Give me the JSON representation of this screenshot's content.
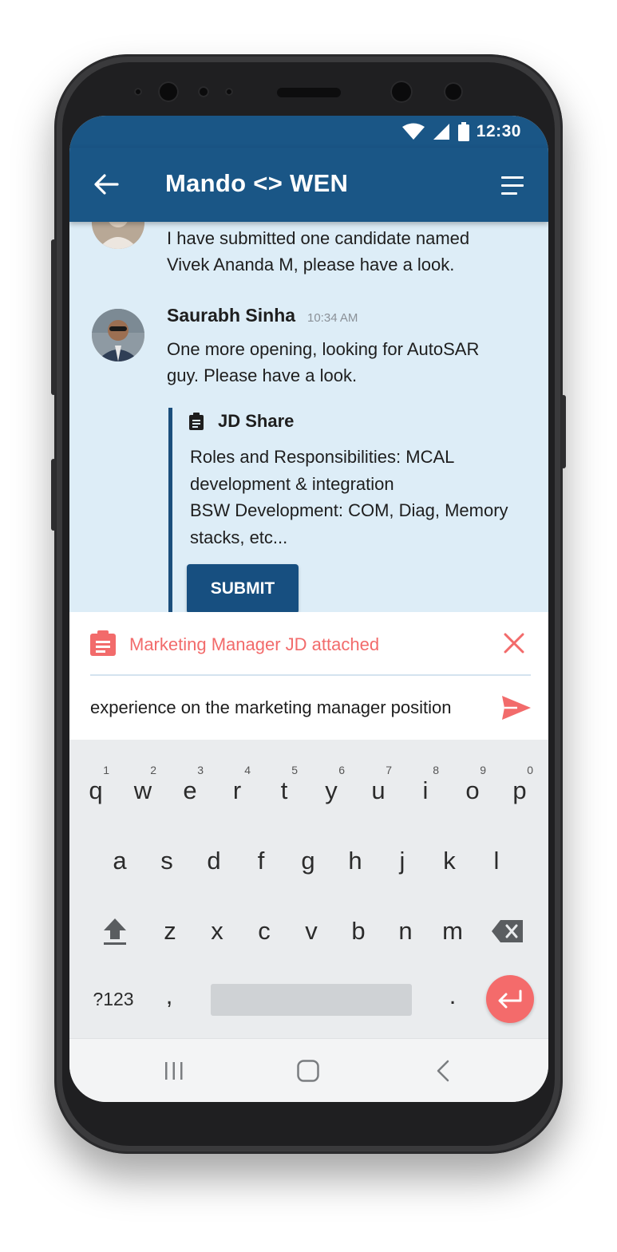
{
  "status_bar": {
    "time": "12:30"
  },
  "app_bar": {
    "title": "Mando <> WEN"
  },
  "chat": {
    "messages": [
      {
        "text": "I have submitted one candidate named Vivek Ananda M, please have a look."
      },
      {
        "sender": "Saurabh Sinha",
        "time": "10:34 AM",
        "text": "One more opening, looking for AutoSAR guy. Please have a look.",
        "jd_card": {
          "title": "JD Share",
          "body_line1": "Roles and Responsibilities: MCAL development & integration",
          "body_line2": "BSW Development: COM, Diag, Memory stacks, etc...",
          "button_label": "SUBMIT"
        }
      }
    ]
  },
  "composer": {
    "attachment_label": "Marketing Manager JD attached",
    "input_value": "experience on the marketing manager position"
  },
  "keyboard": {
    "row1": [
      "q",
      "w",
      "e",
      "r",
      "t",
      "y",
      "u",
      "i",
      "o",
      "p"
    ],
    "row1_numbers": [
      "1",
      "2",
      "3",
      "4",
      "5",
      "6",
      "7",
      "8",
      "9",
      "0"
    ],
    "row2": [
      "a",
      "s",
      "d",
      "f",
      "g",
      "h",
      "j",
      "k",
      "l"
    ],
    "row3": [
      "z",
      "x",
      "c",
      "v",
      "b",
      "n",
      "m"
    ],
    "symbols_label": "?123",
    "comma": ",",
    "period": "."
  },
  "colors": {
    "primary": "#1a5686",
    "chat_bg": "#ddedf7",
    "accent": "#f26b6b",
    "button": "#174f80"
  }
}
